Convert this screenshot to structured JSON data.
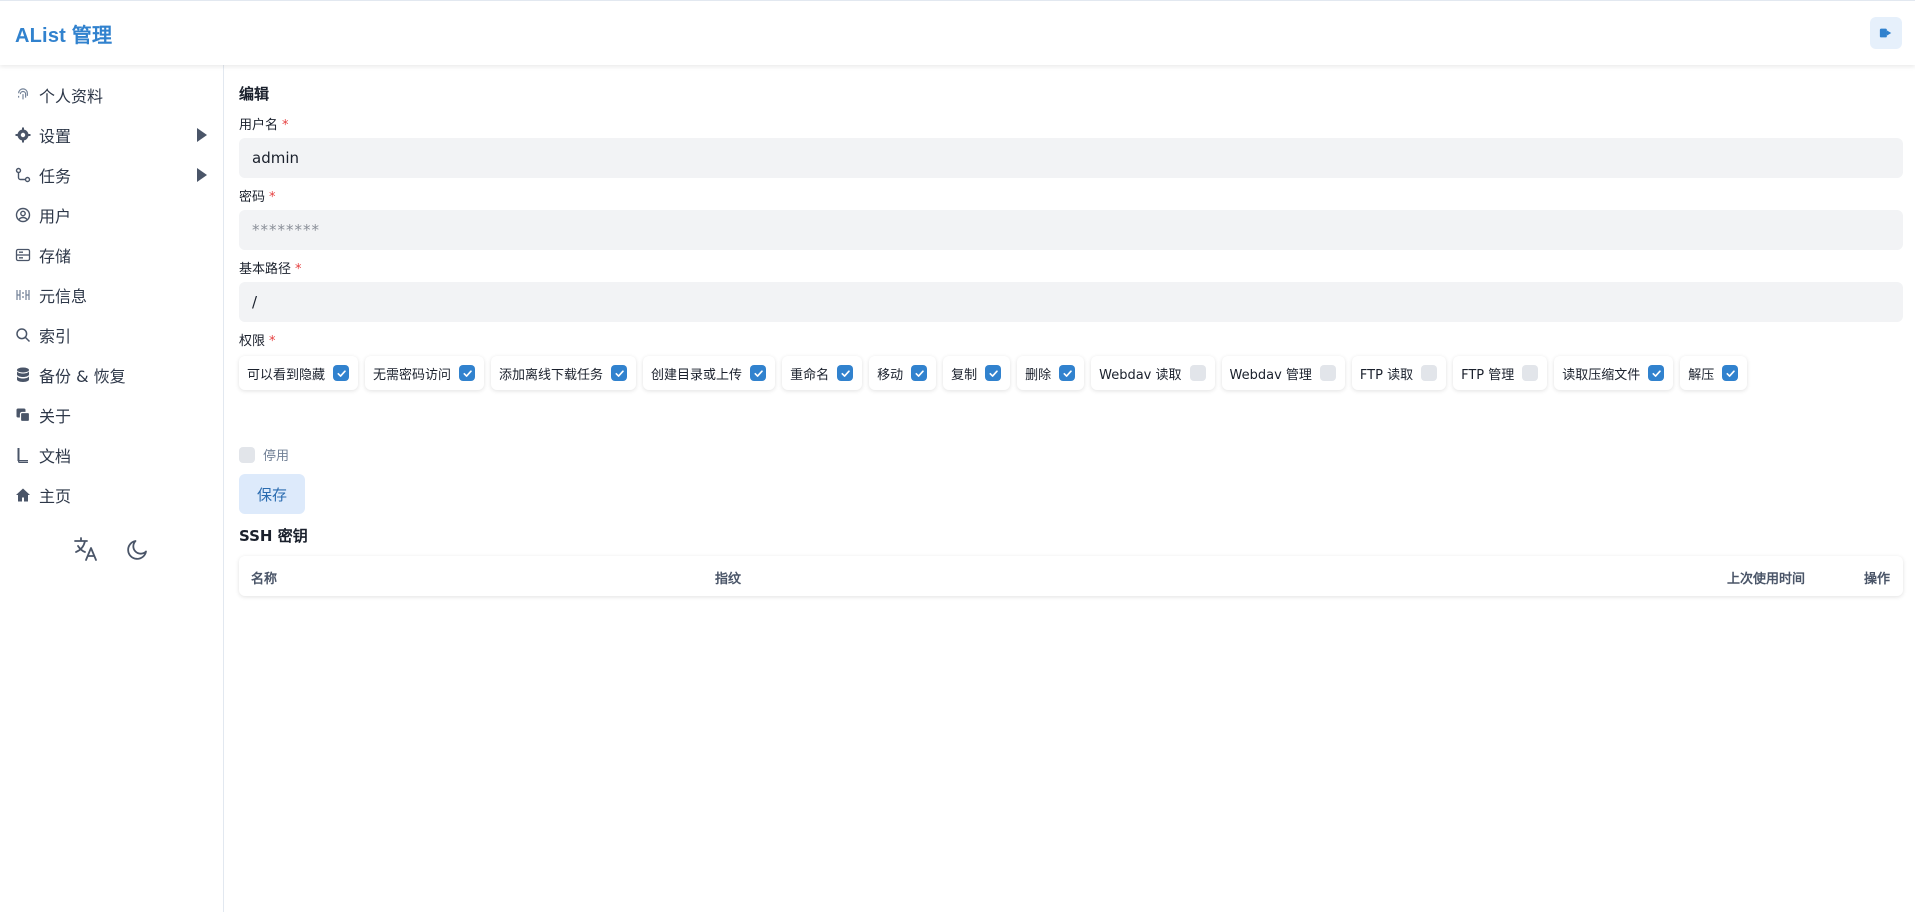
{
  "header": {
    "title": "AList 管理",
    "logout_icon": "logout-icon"
  },
  "sidebar": {
    "items": [
      {
        "label": "个人资料",
        "icon": "fingerprint-icon",
        "has_arrow": false
      },
      {
        "label": "设置",
        "icon": "gear-icon",
        "has_arrow": true
      },
      {
        "label": "任务",
        "icon": "workflow-icon",
        "has_arrow": true
      },
      {
        "label": "用户",
        "icon": "user-circle-icon",
        "has_arrow": false
      },
      {
        "label": "存储",
        "icon": "storage-icon",
        "has_arrow": false
      },
      {
        "label": "元信息",
        "icon": "meta-icon",
        "has_arrow": false
      },
      {
        "label": "索引",
        "icon": "search-icon",
        "has_arrow": false
      },
      {
        "label": "备份 & 恢复",
        "icon": "database-icon",
        "has_arrow": false
      },
      {
        "label": "关于",
        "icon": "copy-icon",
        "has_arrow": false
      },
      {
        "label": "文档",
        "icon": "book-icon",
        "has_arrow": false
      },
      {
        "label": "主页",
        "icon": "home-icon",
        "has_arrow": false
      }
    ],
    "tools": [
      "translate-icon",
      "moon-icon"
    ]
  },
  "form": {
    "title": "编辑",
    "username_label": "用户名",
    "username_value": "admin",
    "password_label": "密码",
    "password_placeholder": "********",
    "base_path_label": "基本路径",
    "base_path_value": "/",
    "permissions_label": "权限",
    "required_mark": "*",
    "permissions": [
      {
        "label": "可以看到隐藏",
        "checked": true
      },
      {
        "label": "无需密码访问",
        "checked": true
      },
      {
        "label": "添加离线下载任务",
        "checked": true
      },
      {
        "label": "创建目录或上传",
        "checked": true
      },
      {
        "label": "重命名",
        "checked": true
      },
      {
        "label": "移动",
        "checked": true
      },
      {
        "label": "复制",
        "checked": true
      },
      {
        "label": "删除",
        "checked": true
      },
      {
        "label": "Webdav 读取",
        "checked": false
      },
      {
        "label": "Webdav 管理",
        "checked": false
      },
      {
        "label": "FTP 读取",
        "checked": false
      },
      {
        "label": "FTP 管理",
        "checked": false
      },
      {
        "label": "读取压缩文件",
        "checked": true
      },
      {
        "label": "解压",
        "checked": true
      }
    ],
    "disable_label": "停用",
    "disable_checked": false,
    "save_label": "保存"
  },
  "ssh": {
    "title": "SSH 密钥",
    "columns": [
      "名称",
      "指纹",
      "上次使用时间",
      "操作"
    ]
  },
  "colors": {
    "accent": "#3182ce",
    "unchecked": "#e2e5ea"
  }
}
